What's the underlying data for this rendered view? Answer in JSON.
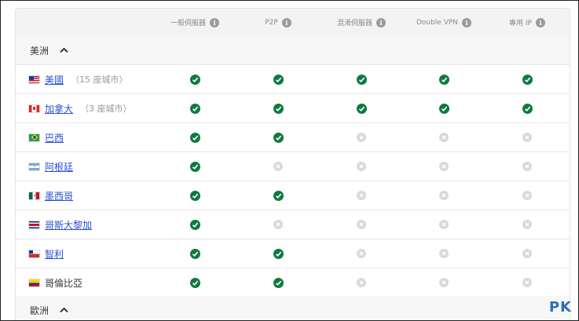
{
  "header": {
    "columns": [
      {
        "label": "一般伺服器",
        "info_icon": "info-icon"
      },
      {
        "label": "P2P",
        "info_icon": "info-icon"
      },
      {
        "label": "混淆伺服器",
        "info_icon": "info-icon"
      },
      {
        "label": "Double VPN",
        "info_icon": "info-icon"
      },
      {
        "label": "專用 IP",
        "info_icon": "info-icon"
      }
    ]
  },
  "regions": [
    {
      "label": "美洲",
      "chevron": "chevron-up-icon"
    },
    {
      "label": "歐洲",
      "chevron": "chevron-up-icon"
    }
  ],
  "rows": [
    {
      "name": "美國",
      "note": "（15 座城市）",
      "flag": "us",
      "link": true,
      "support": [
        true,
        true,
        true,
        true,
        true
      ]
    },
    {
      "name": "加拿大",
      "note": "（3 座城市）",
      "flag": "ca",
      "link": true,
      "support": [
        true,
        true,
        true,
        true,
        true
      ]
    },
    {
      "name": "巴西",
      "note": "",
      "flag": "br",
      "link": true,
      "support": [
        true,
        true,
        false,
        false,
        false
      ]
    },
    {
      "name": "阿根廷",
      "note": "",
      "flag": "ar",
      "link": true,
      "support": [
        true,
        false,
        false,
        false,
        false
      ]
    },
    {
      "name": "墨西哥",
      "note": "",
      "flag": "mx",
      "link": true,
      "support": [
        true,
        true,
        false,
        false,
        false
      ]
    },
    {
      "name": "哥斯大黎加",
      "note": "",
      "flag": "cr",
      "link": true,
      "support": [
        true,
        false,
        false,
        false,
        false
      ]
    },
    {
      "name": "智利",
      "note": "",
      "flag": "cl",
      "link": true,
      "support": [
        true,
        true,
        false,
        false,
        false
      ]
    },
    {
      "name": "哥倫比亞",
      "note": "",
      "flag": "co",
      "link": false,
      "support": [
        true,
        true,
        false,
        false,
        false
      ]
    }
  ],
  "colors": {
    "check": "#0f7a3f",
    "cross": "#d9d9d9",
    "link": "#2a4fd6",
    "watermark": "#2b6fb4"
  },
  "watermark": "PK"
}
